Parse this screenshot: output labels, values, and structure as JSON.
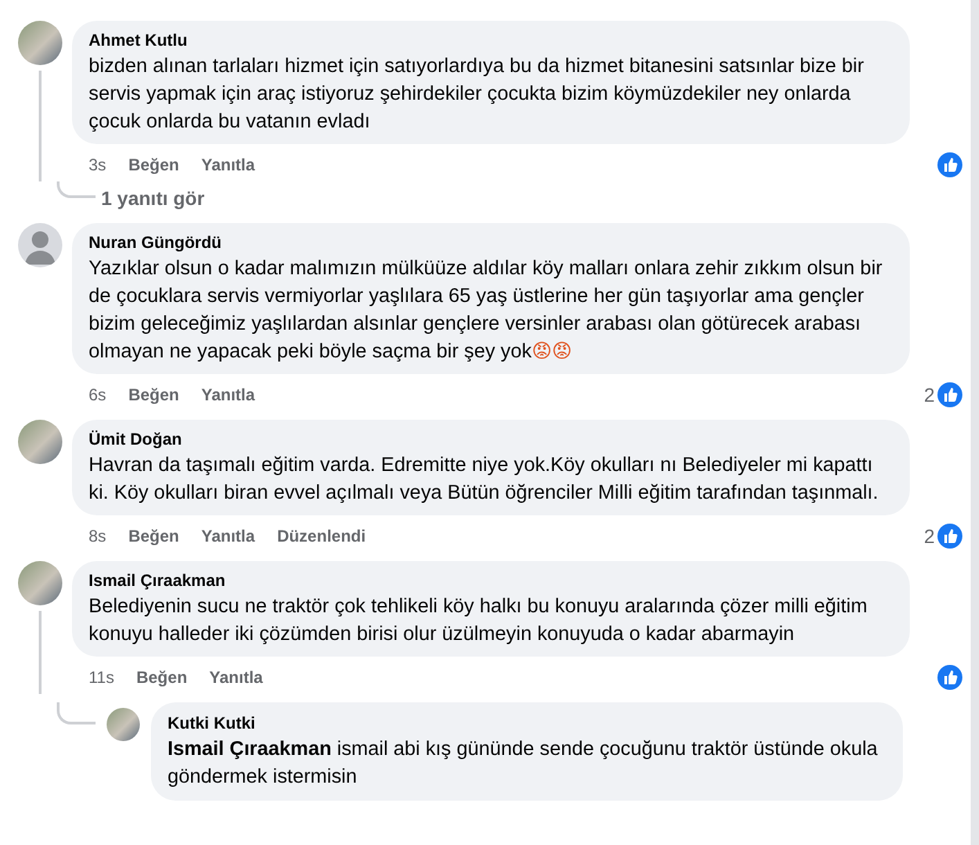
{
  "comments": [
    {
      "name": "Ahmet Kutlu",
      "default_avatar": false,
      "text": "bizden alınan tarlaları hizmet için satıyorlardıya bu da hizmet bitanesini satsınlar bize bir servis yapmak için araç istiyoruz şehirdekiler çocukta bizim köymüzdekiler ney onlarda çocuk onlarda bu vatanın evladı",
      "time": "3s",
      "like": "Beğen",
      "reply": "Yanıtla",
      "replies_link": "1 yanıtı gör"
    },
    {
      "name": "Nuran Güngördü",
      "default_avatar": true,
      "text": "Yazıklar olsun o kadar malımızın mülküüze aldılar köy malları onlara zehir zıkkım olsun bir de çocuklara servis vermiyorlar yaşlılara 65 yaş üstlerine her gün taşıyorlar ama gençler bizim geleceğimiz yaşlılardan alsınlar gençlere versinler arabası olan götürecek arabası olmayan ne yapacak peki böyle saçma bir şey yok",
      "emojis": "😡😡",
      "time": "6s",
      "like": "Beğen",
      "reply": "Yanıtla",
      "reaction_count": "2"
    },
    {
      "name": "Ümit Doğan",
      "default_avatar": false,
      "text": "Havran da taşımalı eğitim varda. Edremitte niye yok.Köy okulları nı Belediyeler mi kapattı ki. Köy okulları biran evvel açılmalı veya Bütün öğrenciler Milli eğitim tarafından taşınmalı.",
      "time": "8s",
      "like": "Beğen",
      "reply": "Yanıtla",
      "edited": "Düzenlendi",
      "reaction_count": "2"
    },
    {
      "name": "Ismail Çıraakman",
      "default_avatar": false,
      "text": "Belediyenin sucu ne traktör çok tehlikeli köy halkı bu konuyu aralarında çözer milli eğitim konuyu halleder iki çözümden birisi olur üzülmeyin konuyuda o kadar abarmayin",
      "time": "11s",
      "like": "Beğen",
      "reply": "Yanıtla",
      "replies": [
        {
          "name": "Kutki Kutki",
          "default_avatar": false,
          "text": "**Ismail Çıraakman** ismail abi kış gününde sende çocuğunu traktör üstünde okula göndermek istermisin"
        }
      ]
    }
  ]
}
